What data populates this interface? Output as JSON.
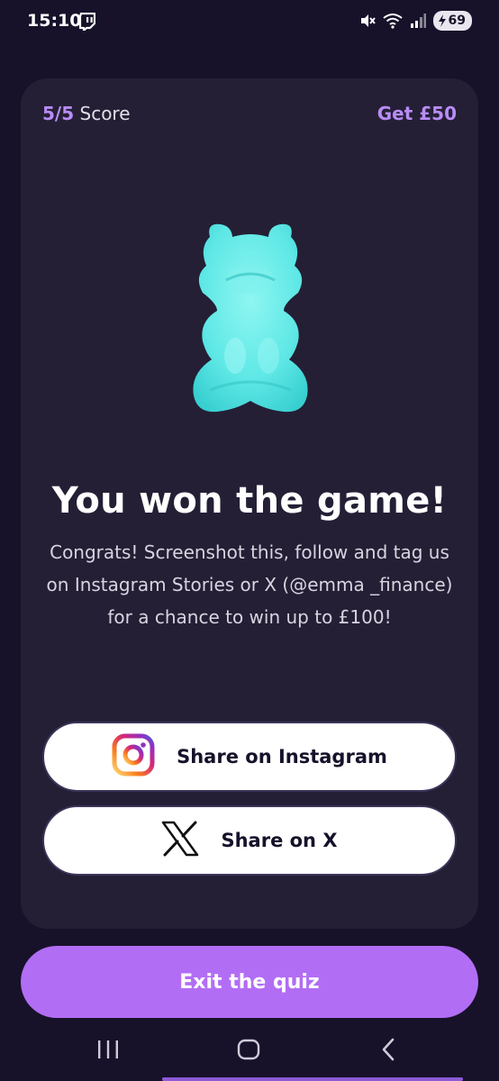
{
  "status_bar": {
    "time": "15:10",
    "battery": "69",
    "icons": [
      "twitch-icon",
      "mute-icon",
      "wifi-icon",
      "signal-icon",
      "battery-icon"
    ]
  },
  "card": {
    "score_value": "5/5",
    "score_label": "Score",
    "reward": "Get £50",
    "image": "gummy-bear-icon",
    "headline": "You won the game!",
    "body": "Congrats! Screenshot this, follow and tag us on Instagram Stories or X (@emma _finance) for a chance to win up to £100!",
    "buttons": {
      "instagram": "Share on Instagram",
      "x": "Share on X"
    }
  },
  "exit_button": "Exit the quiz",
  "nav_bar": {
    "icons": [
      "recents-icon",
      "home-icon",
      "back-icon"
    ]
  },
  "colors": {
    "background": "#17122a",
    "card": "#241f35",
    "accent": "#b98cf6",
    "exit_button": "#b26df5",
    "gummy_bear": "#5fe8e6"
  }
}
